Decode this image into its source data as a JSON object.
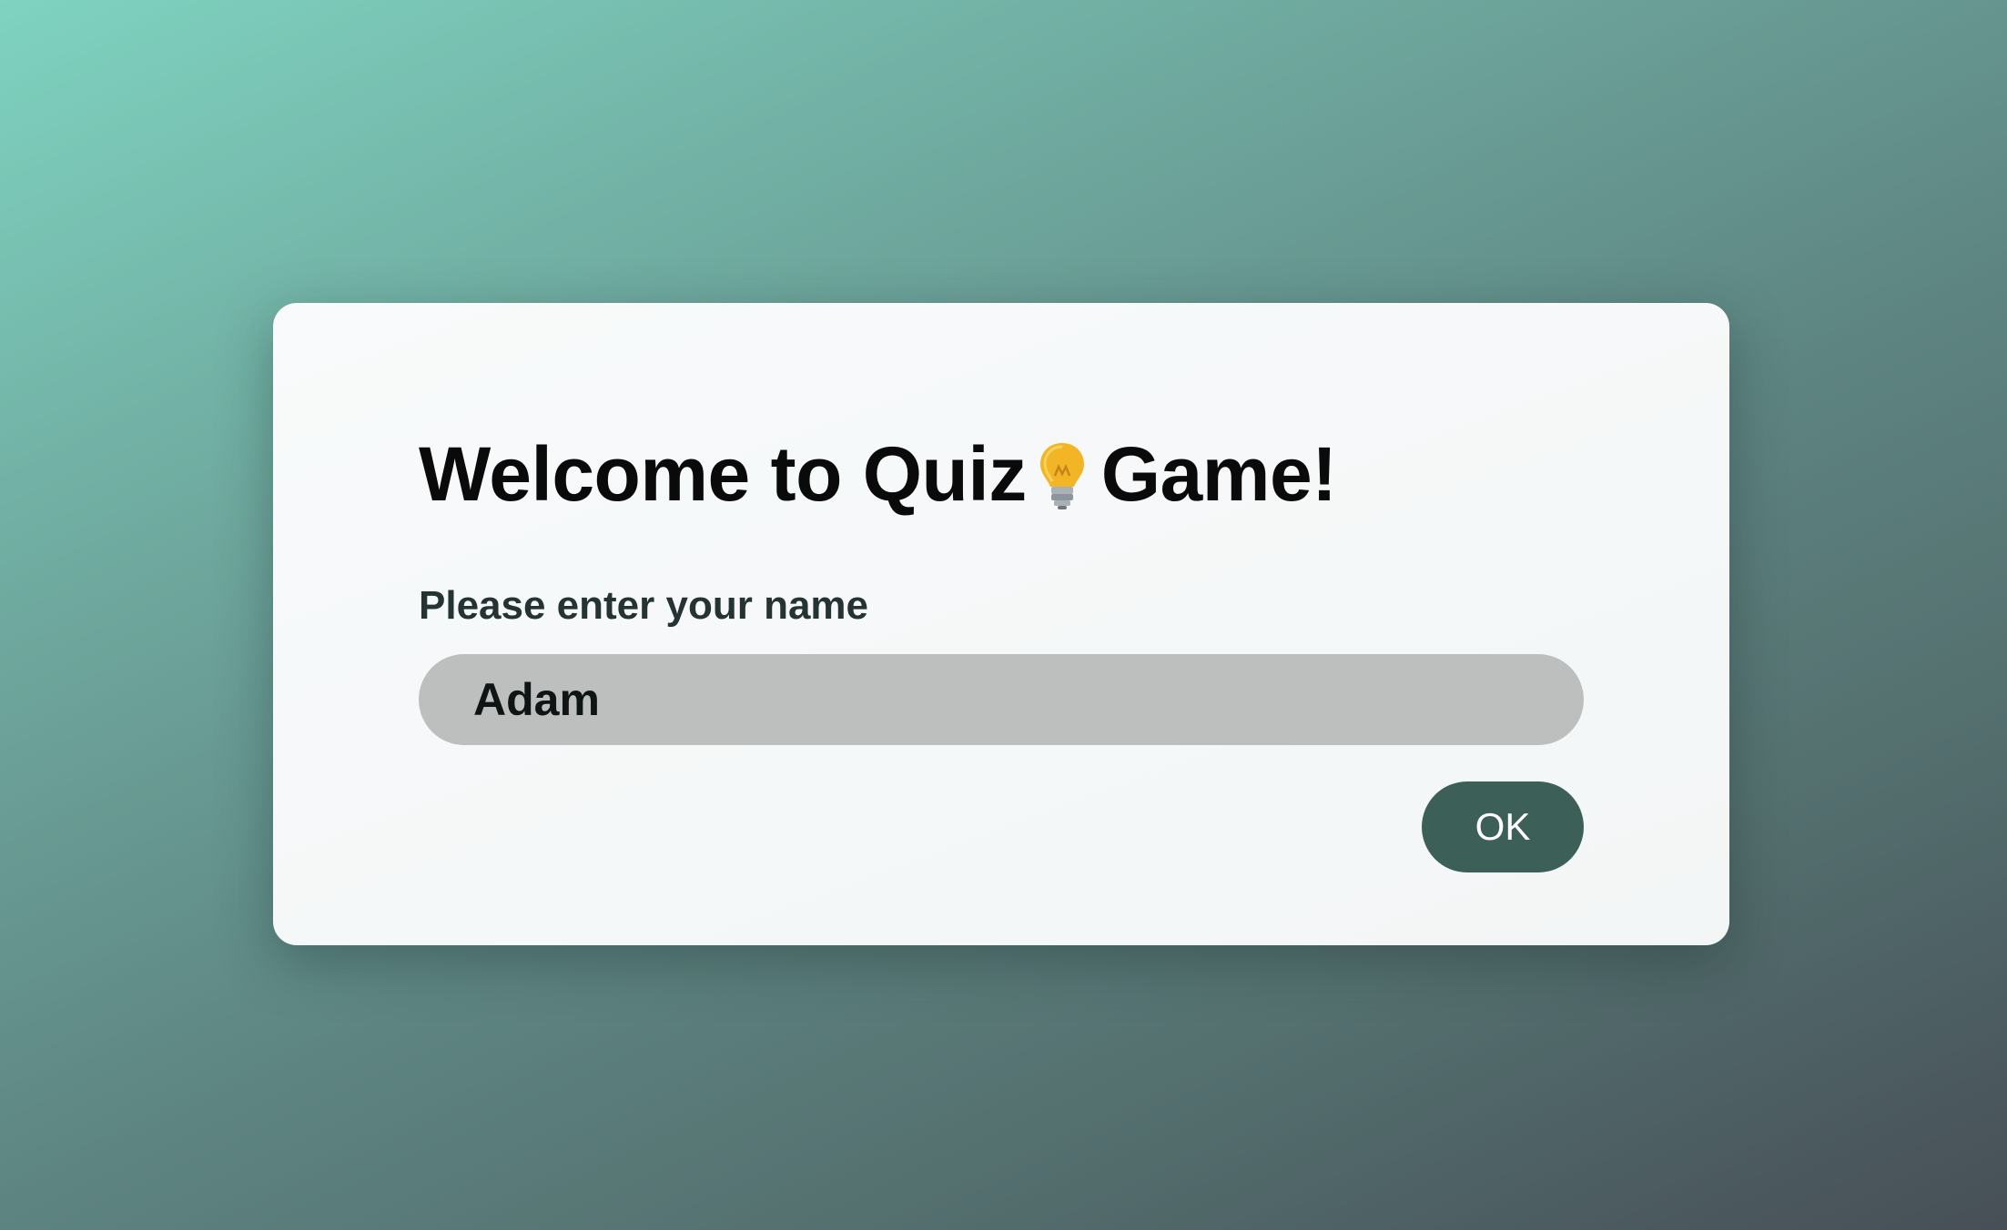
{
  "dialog": {
    "title_prefix": "Welcome to Quiz",
    "title_icon": "lightbulb-icon",
    "title_suffix": "Game!",
    "name_label": "Please enter your name",
    "name_input_value": "Adam",
    "ok_label": "OK"
  },
  "colors": {
    "background_start": "#7fd3c0",
    "background_end": "#474f57",
    "card": "#f6f8f8",
    "input_background": "#bdbfbe",
    "ok_button": "#3c5f58",
    "bulb": "#f2b526"
  }
}
